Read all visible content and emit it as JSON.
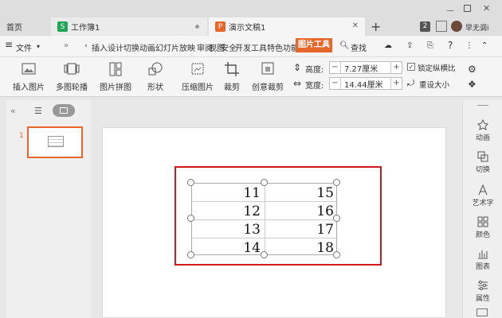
{
  "tabs": {
    "home": "首页",
    "sheet": {
      "label": "工作簿1",
      "icon": "S"
    },
    "doc": {
      "label": "演示文稿1",
      "icon": "P"
    },
    "add": "+"
  },
  "window": {
    "badge": "2",
    "user": "早无调i"
  },
  "menu": {
    "file": "文件",
    "more": "»",
    "items": [
      "插入",
      "设计",
      "切换",
      "动画",
      "幻灯片放映",
      "审阅",
      "视图",
      "安全",
      "开发工具",
      "特色功能"
    ],
    "active": "图片工具",
    "search": "查找",
    "help": "?"
  },
  "ribbon": {
    "buttons": [
      "插入图片",
      "多图轮播",
      "图片拼图",
      "形状",
      "压缩图片",
      "裁剪",
      "创意裁剪"
    ],
    "height_label": "高度:",
    "height_value": "7.27厘米",
    "width_label": "宽度:",
    "width_value": "14.44厘米",
    "lock_ratio": "锁定纵横比",
    "reset_size": "重设大小"
  },
  "slides": {
    "number": "1"
  },
  "right_panel": [
    "动画",
    "切换",
    "艺术字",
    "颜色",
    "图表",
    "属性"
  ],
  "table": {
    "rows": [
      [
        "11",
        "15"
      ],
      [
        "12",
        "16"
      ],
      [
        "13",
        "17"
      ],
      [
        "14",
        "18"
      ]
    ]
  },
  "colors": {
    "accent": "#e7672a",
    "sheet": "#22a35a",
    "highlight": "#d0191d"
  }
}
